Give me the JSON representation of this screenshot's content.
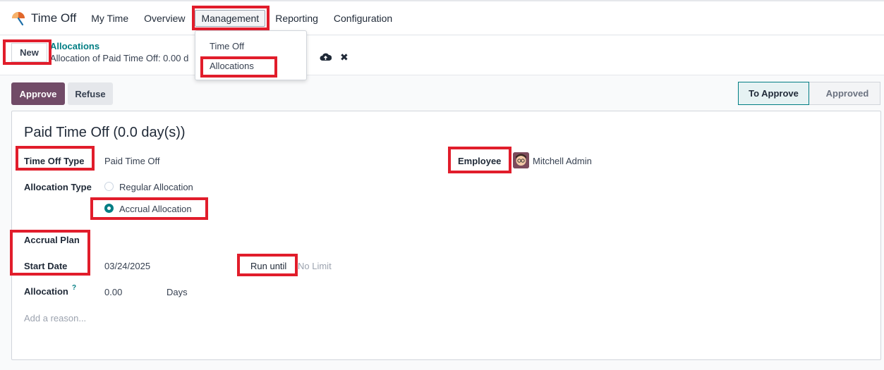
{
  "topbar": {
    "app_title": "Time Off",
    "menu": [
      "My Time",
      "Overview",
      "Management",
      "Reporting",
      "Configuration"
    ]
  },
  "dropdown": {
    "items": [
      "Time Off",
      "Allocations"
    ]
  },
  "control": {
    "new_label": "New",
    "breadcrumb_parent": "Allocations",
    "breadcrumb_current": "Allocation of Paid Time Off: 0.00 d"
  },
  "actions": {
    "approve": "Approve",
    "refuse": "Refuse",
    "stages": [
      "To Approve",
      "Approved"
    ]
  },
  "form": {
    "title": "Paid Time Off (0.0 day(s))",
    "time_off_type_label": "Time Off Type",
    "time_off_type_value": "Paid Time Off",
    "employee_label": "Employee",
    "employee_value": "Mitchell Admin",
    "allocation_type_label": "Allocation Type",
    "allocation_options": [
      "Regular Allocation",
      "Accrual Allocation"
    ],
    "accrual_plan_label": "Accrual Plan",
    "start_date_label": "Start Date",
    "start_date_value": "03/24/2025",
    "run_until_label": "Run until",
    "run_until_placeholder": "No Limit",
    "allocation_label": "Allocation",
    "allocation_help": "?",
    "allocation_value": "0.00",
    "allocation_unit": "Days",
    "reason_placeholder": "Add a reason..."
  },
  "colors": {
    "primary": "#714b67",
    "accent": "#017e84",
    "highlight": "#e11d2b"
  }
}
